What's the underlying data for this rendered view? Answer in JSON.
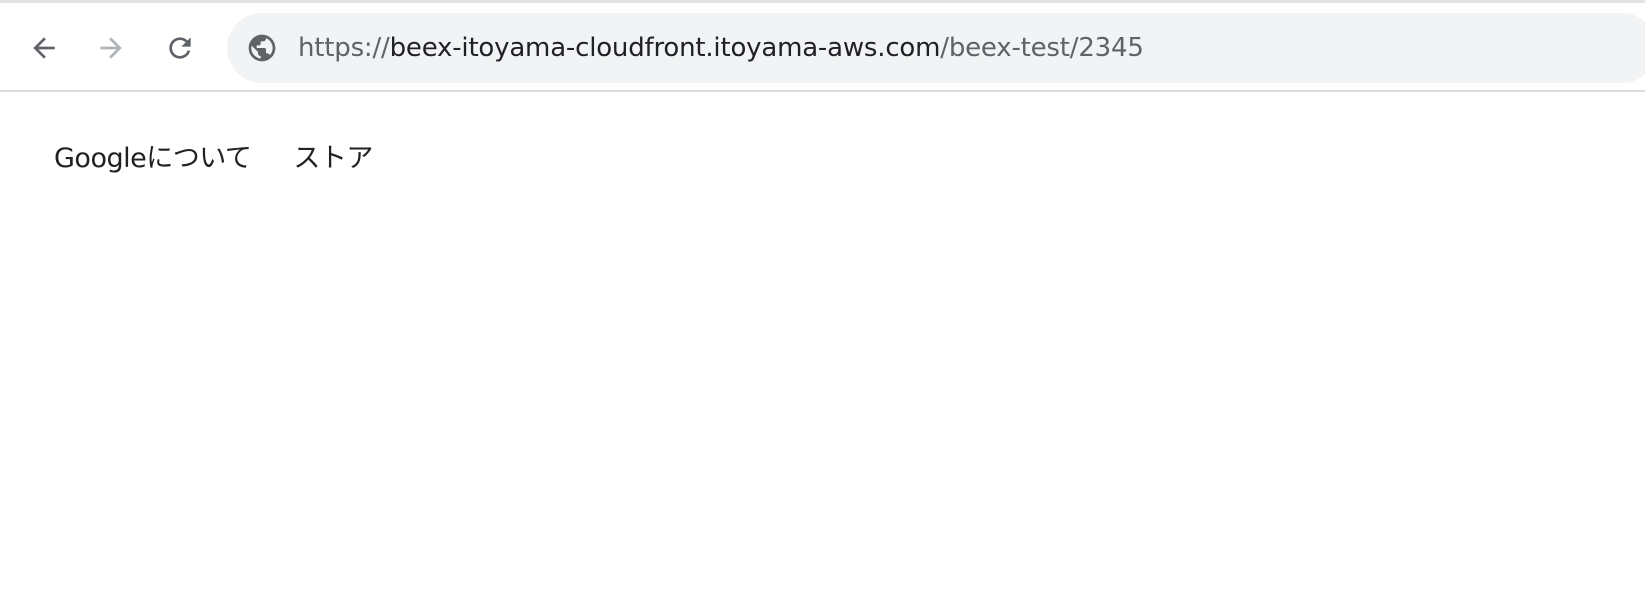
{
  "browser": {
    "nav": {
      "back_icon": "arrow-left-icon",
      "forward_icon": "arrow-right-icon",
      "reload_icon": "reload-icon"
    },
    "omnibox": {
      "site_icon": "globe-icon",
      "url_scheme": "https://",
      "url_host": "beex-itoyama-cloudfront.itoyama-aws.com",
      "url_path": "/beex-test/2345"
    },
    "colors": {
      "toolbar_bg": "#ffffff",
      "omnibox_bg": "#f1f3f4",
      "icon_active": "#5f6368",
      "icon_disabled": "#b0b3b8",
      "text_primary": "#202124"
    }
  },
  "page": {
    "links": [
      {
        "label": "Googleについて"
      },
      {
        "label": "ストア"
      }
    ]
  }
}
